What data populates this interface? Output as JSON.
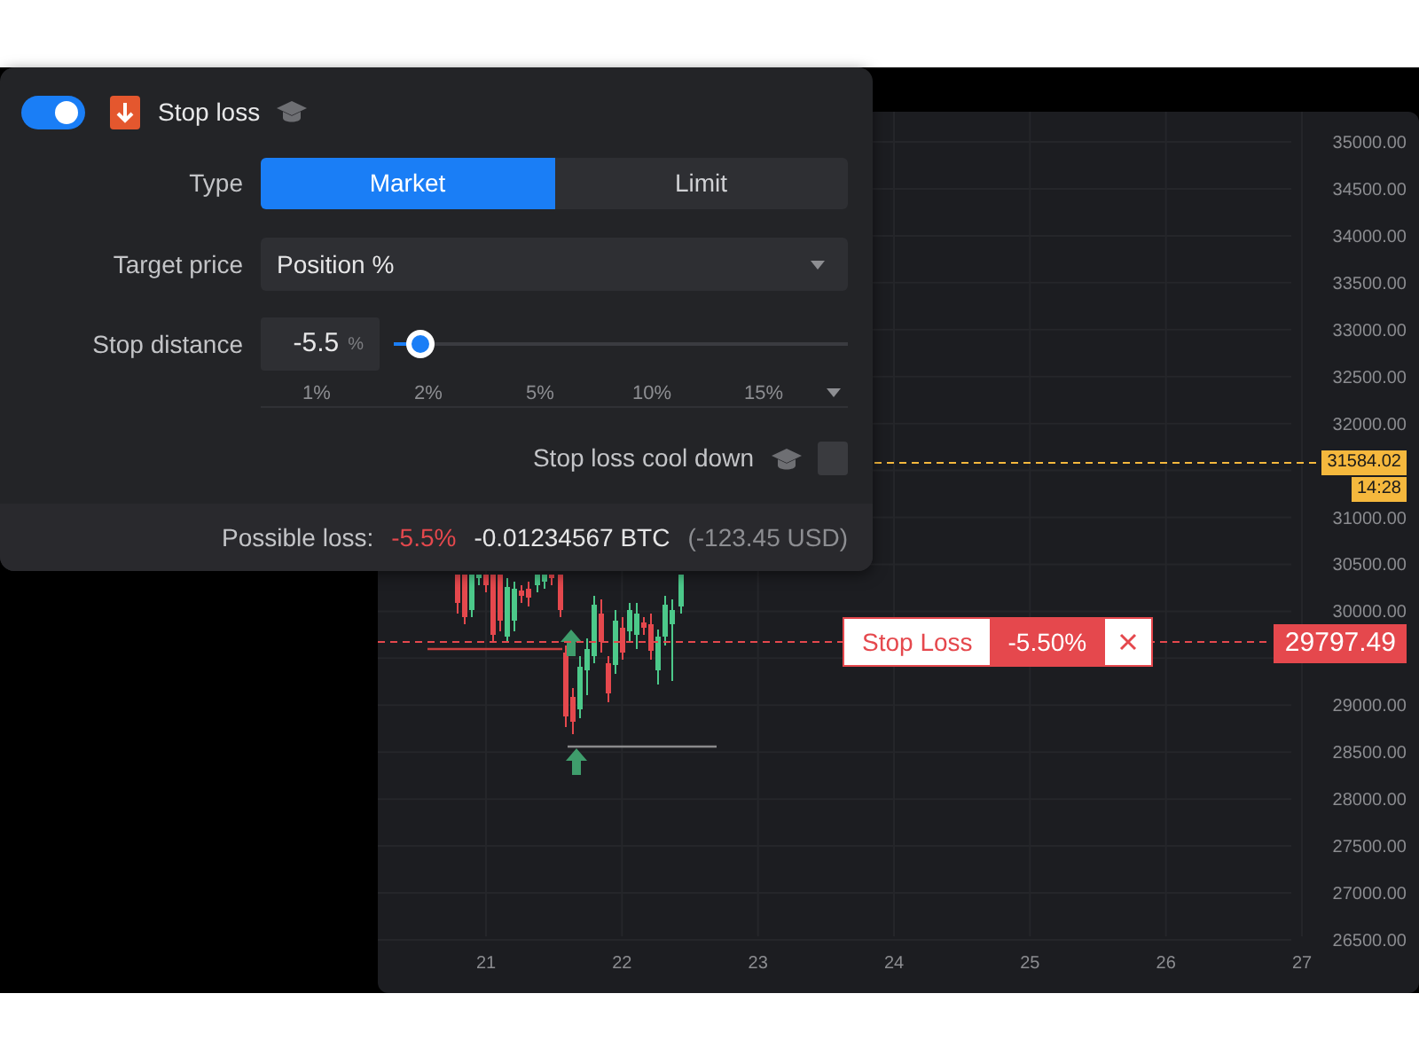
{
  "stop_loss": {
    "on": true,
    "title": "Stop loss",
    "type": {
      "label": "Type",
      "options": [
        {
          "label": "Market",
          "selected": true
        },
        {
          "label": "Limit",
          "selected": false
        }
      ]
    },
    "target_price": {
      "label": "Target price",
      "value": "Position %"
    },
    "stop_distance": {
      "label": "Stop distance",
      "value": "-5.5",
      "unit": "%",
      "level": 0.06,
      "presets": [
        "1%",
        "2%",
        "5%",
        "10%",
        "15%"
      ]
    },
    "cool_down": {
      "label": "Stop loss cool down",
      "checked": false
    },
    "possible_loss": {
      "label": "Possible loss:",
      "percent": "-5.5%",
      "amount": "-0.01234567 BTC",
      "fiat": "(-123.45 USD)"
    }
  },
  "chart": {
    "price_axis": [
      "35000.00",
      "34500.00",
      "34000.00",
      "33500.00",
      "33000.00",
      "32500.00",
      "32000.00",
      "31000.00",
      "30500.00",
      "30000.00",
      "29000.00",
      "28500.00",
      "28000.00",
      "27500.00",
      "27000.00",
      "26500.00"
    ],
    "date_axis": [
      "21",
      "22",
      "23",
      "24",
      "25",
      "26",
      "27"
    ],
    "last_price": {
      "price": "31584.02",
      "countdown": "14:28"
    },
    "stop_loss_order": {
      "label": "Stop Loss",
      "percent": "-5.50%",
      "price": "29797.49"
    }
  }
}
